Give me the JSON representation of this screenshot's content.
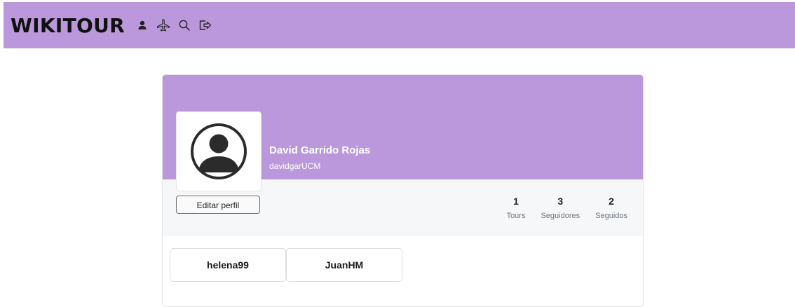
{
  "navbar": {
    "brand": "WIKITOUR",
    "icons": [
      "person-icon",
      "airplane-icon",
      "search-icon",
      "logout-icon"
    ],
    "background": "#bb98dc"
  },
  "profile": {
    "name": "David Garrido Rojas",
    "username": "davidgarUCM",
    "edit_label": "Editar perfil",
    "stats": [
      {
        "value": "1",
        "label": "Tours"
      },
      {
        "value": "3",
        "label": "Seguidores"
      },
      {
        "value": "2",
        "label": "Seguidos"
      }
    ],
    "following": [
      "helena99",
      "JuanHM"
    ]
  },
  "colors": {
    "accent": "#bb98dc",
    "band": "#f6f7f8"
  }
}
